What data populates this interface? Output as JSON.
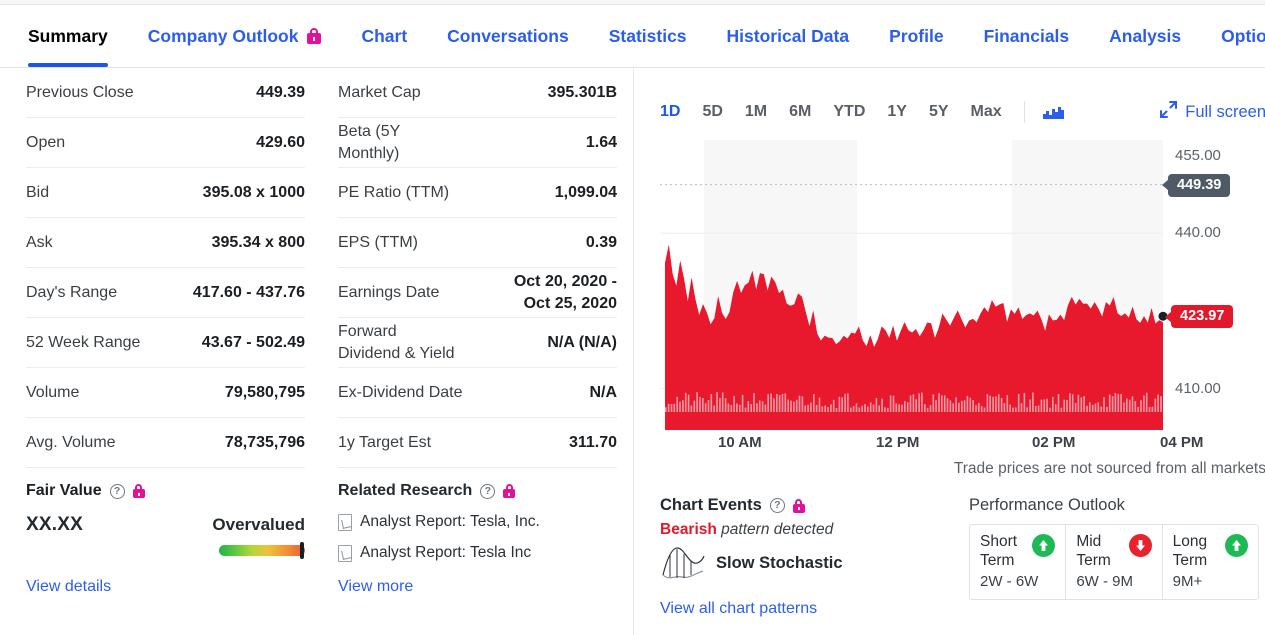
{
  "nav": {
    "tabs": [
      {
        "label": "Summary",
        "active": true,
        "lock": false
      },
      {
        "label": "Company Outlook",
        "active": false,
        "lock": true
      },
      {
        "label": "Chart",
        "active": false,
        "lock": false
      },
      {
        "label": "Conversations",
        "active": false,
        "lock": false
      },
      {
        "label": "Statistics",
        "active": false,
        "lock": false
      },
      {
        "label": "Historical Data",
        "active": false,
        "lock": false
      },
      {
        "label": "Profile",
        "active": false,
        "lock": false
      },
      {
        "label": "Financials",
        "active": false,
        "lock": false
      },
      {
        "label": "Analysis",
        "active": false,
        "lock": false
      },
      {
        "label": "Options",
        "active": false,
        "lock": false
      }
    ]
  },
  "quote_left": [
    {
      "key": "Previous Close",
      "value": "449.39"
    },
    {
      "key": "Open",
      "value": "429.60"
    },
    {
      "key": "Bid",
      "value": "395.08 x 1000"
    },
    {
      "key": "Ask",
      "value": "395.34 x 800"
    },
    {
      "key": "Day's Range",
      "value": "417.60 - 437.76"
    },
    {
      "key": "52 Week Range",
      "value": "43.67 - 502.49"
    },
    {
      "key": "Volume",
      "value": "79,580,795"
    },
    {
      "key": "Avg. Volume",
      "value": "78,735,796"
    }
  ],
  "quote_right": [
    {
      "key": "Market Cap",
      "value": "395.301B"
    },
    {
      "key": "Beta (5Y\nMonthly)",
      "value": "1.64"
    },
    {
      "key": "PE Ratio (TTM)",
      "value": "1,099.04"
    },
    {
      "key": "EPS (TTM)",
      "value": "0.39"
    },
    {
      "key": "Earnings Date",
      "value": "Oct 20, 2020 -\nOct 25, 2020"
    },
    {
      "key": "Forward\nDividend & Yield",
      "value": "N/A (N/A)"
    },
    {
      "key": "Ex-Dividend Date",
      "value": "N/A"
    },
    {
      "key": "1y Target Est",
      "value": "311.70"
    }
  ],
  "fair_value": {
    "title": "Fair Value",
    "help_glyph": "?",
    "value": "XX.XX",
    "verdict": "Overvalued",
    "link": "View details"
  },
  "related_research": {
    "title": "Related Research",
    "help_glyph": "?",
    "items": [
      "Analyst Report: Tesla, Inc.",
      "Analyst Report: Tesla Inc"
    ],
    "link": "View more"
  },
  "chart_toolbar": {
    "ranges": [
      "1D",
      "5D",
      "1M",
      "6M",
      "YTD",
      "1Y",
      "5Y",
      "Max"
    ],
    "active_range": "1D",
    "chart_type_icon": "bar-chart-icon",
    "fullscreen_label": "Full screen",
    "fullscreen_icon": "expand-arrows-icon"
  },
  "chart_data": {
    "type": "area",
    "title": "",
    "xlabel": "",
    "ylabel": "",
    "ylim": [
      402,
      458
    ],
    "yticks": [
      "455.00",
      "440.00",
      "410.00"
    ],
    "ytick_values": [
      455.0,
      440.0,
      410.0
    ],
    "xticks": [
      "10 AM",
      "12 PM",
      "02 PM",
      "04 PM"
    ],
    "grid": true,
    "series_color": "#e1192b",
    "previous_close": 449.39,
    "previous_close_label": "449.39",
    "last_price": 423.97,
    "last_price_label": "423.97",
    "disclaimer": "Trade prices are not sourced from all markets",
    "x": [
      0,
      1,
      2,
      3,
      4,
      5,
      6,
      7,
      8,
      9,
      10,
      11,
      12,
      13,
      14,
      15,
      16,
      17,
      18,
      19,
      20,
      21,
      22,
      23,
      24,
      25,
      26,
      27,
      28,
      29,
      30,
      31,
      32,
      33,
      34,
      35,
      36,
      37,
      38,
      39,
      40,
      41,
      42,
      43,
      44,
      45,
      46,
      47,
      48,
      49,
      50,
      51,
      52,
      53,
      54,
      55,
      56,
      57,
      58,
      59,
      60,
      61,
      62,
      63,
      64,
      65,
      66,
      67,
      68,
      69,
      70,
      71,
      72,
      73,
      74,
      75,
      76,
      77,
      78,
      79,
      80,
      81,
      82,
      83,
      84,
      85,
      86,
      87,
      88,
      89,
      90,
      91,
      92,
      93,
      94,
      95,
      96,
      97,
      98,
      99,
      100,
      101,
      102,
      103,
      104,
      105,
      106,
      107,
      108,
      109,
      110,
      111,
      112,
      113,
      114,
      115,
      116,
      117,
      118,
      119,
      120,
      121,
      122,
      123,
      124,
      125,
      126,
      127,
      128,
      129,
      130
    ],
    "values": [
      434.2,
      437.6,
      433.0,
      430.4,
      434.8,
      431.2,
      427.8,
      430.5,
      427.0,
      424.4,
      426.8,
      424.0,
      422.0,
      424.6,
      427.8,
      425.2,
      423.0,
      425.6,
      428.5,
      430.8,
      429.2,
      431.0,
      429.4,
      431.6,
      430.0,
      432.4,
      431.0,
      429.6,
      431.8,
      430.4,
      428.0,
      429.6,
      427.2,
      424.8,
      426.4,
      429.0,
      427.6,
      425.2,
      422.8,
      424.4,
      421.0,
      419.6,
      421.2,
      418.8,
      420.4,
      417.6,
      419.2,
      420.8,
      419.4,
      421.0,
      420.0,
      421.6,
      420.2,
      418.8,
      420.4,
      419.0,
      420.6,
      422.2,
      420.8,
      419.4,
      421.0,
      419.6,
      421.2,
      422.8,
      421.4,
      420.0,
      421.6,
      420.2,
      421.8,
      423.4,
      422.0,
      420.6,
      422.2,
      423.8,
      422.4,
      421.0,
      422.6,
      424.2,
      422.8,
      421.4,
      423.0,
      424.6,
      423.2,
      424.8,
      426.4,
      425.0,
      426.6,
      425.2,
      426.8,
      425.4,
      424.0,
      425.6,
      424.2,
      425.8,
      424.4,
      423.0,
      424.6,
      423.2,
      424.8,
      423.4,
      422.0,
      423.6,
      422.2,
      423.8,
      425.4,
      424.0,
      425.6,
      427.2,
      425.8,
      426.4,
      427.0,
      425.6,
      426.2,
      427.8,
      426.4,
      425.0,
      426.6,
      425.2,
      426.8,
      425.4,
      424.0,
      425.6,
      424.2,
      425.8,
      424.4,
      423.0,
      424.6,
      423.2,
      424.8,
      423.4,
      424.0,
      423.97
    ],
    "volume_bars": true
  },
  "chart_events": {
    "title": "Chart Events",
    "help_glyph": "?",
    "sentiment": "Bearish",
    "sentiment_suffix": " pattern detected",
    "pattern_name": "Slow Stochastic",
    "link": "View all chart patterns"
  },
  "performance_outlook": {
    "title": "Performance Outlook",
    "cells": [
      {
        "term": "Short\nTerm",
        "range": "2W - 6W",
        "direction": "up"
      },
      {
        "term": "Mid\nTerm",
        "range": "6W - 9M",
        "direction": "down"
      },
      {
        "term": "Long\nTerm",
        "range": "9M+",
        "direction": "up"
      }
    ]
  },
  "colors": {
    "link_blue": "#2b5eea",
    "active_blue": "#1a56e8",
    "lock_magenta": "#e0119d",
    "chart_red": "#e1192b",
    "up_green": "#1db954",
    "down_red": "#e8232f"
  }
}
